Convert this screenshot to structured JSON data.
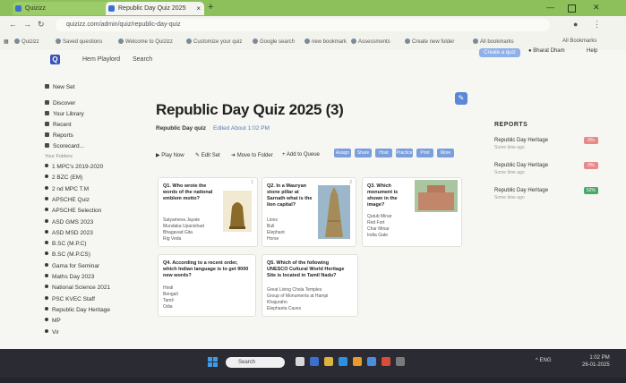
{
  "browser": {
    "tabs": [
      {
        "label": "Quizizz"
      },
      {
        "label": "Republic Day Quiz 2025"
      }
    ],
    "new_tab": "+",
    "window_controls": {
      "minimize": "—",
      "close": "✕"
    },
    "url": "quizizz.com/admin/quiz/republic-day-quiz",
    "bookmarks": [
      "Quizizz",
      "Saved questions",
      "Welcome to Quizizz",
      "Customize your quiz",
      "Google search",
      "new bookmark",
      "Assessments",
      "Create new folder",
      "All bookmarks"
    ],
    "bookmarks_right": "All Bookmarks"
  },
  "topnav": {
    "logo": "Q",
    "links": [
      "Hem Playlord",
      "Search"
    ],
    "create_button": "Create a quiz",
    "user": "Bharat Dham",
    "help": "Help"
  },
  "sidebar": {
    "items": [
      "New Set",
      "Discover",
      "Your Library",
      "Recent",
      "Reports",
      "Scorecard..."
    ],
    "section_label": "Your Folders",
    "folders": [
      "1 MPC's 2019-2020",
      "2 BZC (EM)",
      "2 nd MPC T.M",
      "APSCHE Quiz",
      "APSCHE Selection",
      "ASD GMS 2023",
      "ASD MSD 2023",
      "B.SC (M.P.C)",
      "B.SC (M.P.CS)",
      "Gama for Seminar",
      "Maths Day 2023",
      "National Science 2021",
      "PSC KVEC Staff",
      "Republic Day Heritage",
      "MP",
      "Vir"
    ]
  },
  "main": {
    "title": "Republic Day Quiz 2025 (3)",
    "author": "Republic Day quiz",
    "edited": "Edited About 1:02 PM",
    "actions": [
      "Play Now",
      "Edit Set",
      "Move to Folder",
      "Add to Queue"
    ],
    "pills": [
      "Assign",
      "Share",
      "Host",
      "Practice",
      "Print",
      "More"
    ],
    "cards": [
      {
        "num": "1",
        "question": "Q1. Who wrote the words of the national emblem motto?",
        "options": [
          "Satyameva Jayate",
          "Mundaka Upanishad",
          "Bhagavad Gita",
          "Rig Veda"
        ]
      },
      {
        "num": "2",
        "question": "Q2. In a Mauryan stone pillar at Sarnath what is the lion capital?",
        "options": [
          "Lions",
          "Bull",
          "Elephant",
          "Horse"
        ]
      },
      {
        "num": "3",
        "question": "Q3. Which monument is shown in the image?",
        "options": [
          "Qutub Minar",
          "Red Fort",
          "Char Minar",
          "India Gate"
        ]
      },
      {
        "num": "4",
        "question": "Q4. According to a recent order, which Indian language is to get 9000 new words?",
        "options": [
          "Hindi",
          "Bengali",
          "Tamil",
          "Odia"
        ]
      },
      {
        "num": "5",
        "question": "Q5. Which of the following UNESCO Cultural World Heritage Site is located in Tamil Nadu?",
        "options": [
          "Great Living Chola Temples",
          "Group of Monuments at Hampi",
          "Khajuraho",
          "Elephanta Caves"
        ]
      }
    ]
  },
  "reports": {
    "heading": "REPORTS",
    "items": [
      {
        "title": "Republic Day Heritage",
        "sub": "Some time ago",
        "badge": "0%",
        "badge_color": "#e68a8a"
      },
      {
        "title": "Republic Day Heritage",
        "sub": "Some time ago",
        "badge": "0%",
        "badge_color": "#e68a8a"
      },
      {
        "title": "Republic Day Heritage",
        "sub": "Some time ago",
        "badge": "52%",
        "badge_color": "#4aa86a"
      }
    ]
  },
  "taskbar": {
    "search_placeholder": "Search",
    "tray": "^ ENG",
    "time": "1:02 PM",
    "date": "26-01-2025"
  },
  "colors": {
    "accent": "#5b87d6",
    "tabbar": "#8dbf5a",
    "taskbar": "#25262c"
  }
}
